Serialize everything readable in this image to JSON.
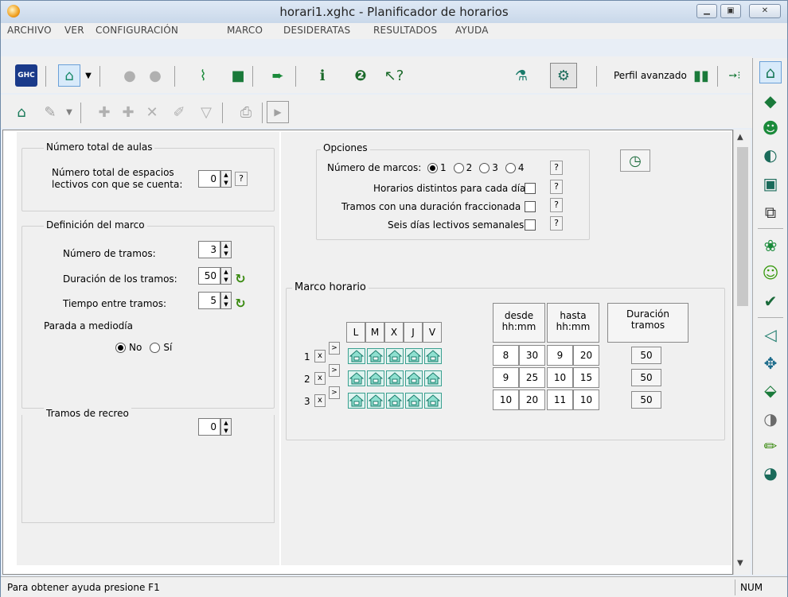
{
  "window": {
    "title": "horari1.xghc - Planificador de horarios"
  },
  "menu": [
    "ARCHIVO",
    "VER",
    "CONFIGURACIÓN",
    "MARCO",
    "DESIDERATAS",
    "RESULTADOS",
    "AYUDA"
  ],
  "toolbar": {
    "ghc_label": "GHC",
    "profile_label": "Perfil avanzado"
  },
  "aulas": {
    "group_label": "Número total de aulas",
    "field_label_line1": "Número total de espacios",
    "field_label_line2": "lectivos con que se cuenta:",
    "value": "0",
    "help": "?"
  },
  "marco_def": {
    "group_label": "Definición del marco",
    "num_tramos_label": "Número de tramos:",
    "num_tramos_value": "3",
    "duracion_label": "Duración de los tramos:",
    "duracion_value": "50",
    "tiempo_label": "Tiempo entre tramos:",
    "tiempo_value": "5"
  },
  "parada": {
    "label": "Parada a mediodía",
    "opt_no": "No",
    "opt_si": "Sí",
    "selected": "No"
  },
  "recreo": {
    "label": "Tramos de recreo",
    "value": "0"
  },
  "opciones": {
    "group_label": "Opciones",
    "num_marcos_label": "Número de marcos:",
    "marcos": [
      "1",
      "2",
      "3",
      "4"
    ],
    "selected_marco": "1",
    "distintos_label": "Horarios distintos para cada día",
    "fraccionada_label": "Tramos con una duración fraccionada",
    "seis_dias_label": "Seis días lectivos semanales",
    "help": "?"
  },
  "marco_horario": {
    "label": "Marco horario",
    "days": [
      "L",
      "M",
      "X",
      "J",
      "V"
    ],
    "desde_header_1": "desde",
    "desde_header_2": "hh:mm",
    "hasta_header_1": "hasta",
    "hasta_header_2": "hh:mm",
    "duracion_header_1": "Duración",
    "duracion_header_2": "tramos",
    "rows": [
      {
        "num": "1",
        "x": "x",
        "next": ">",
        "desde_h": "8",
        "desde_m": "30",
        "hasta_h": "9",
        "hasta_m": "20",
        "duracion": "50"
      },
      {
        "num": "2",
        "x": "x",
        "next": ">",
        "desde_h": "9",
        "desde_m": "25",
        "hasta_h": "10",
        "hasta_m": "15",
        "duracion": "50"
      },
      {
        "num": "3",
        "x": "x",
        "next": ">",
        "desde_h": "10",
        "desde_m": "20",
        "hasta_h": "11",
        "hasta_m": "10",
        "duracion": "50"
      }
    ]
  },
  "status": {
    "help_text": "Para obtener ayuda presione F1",
    "num": "NUM"
  },
  "colors": {
    "accent_green": "#3a8a10",
    "house_teal": "#2a9a88",
    "frame_blue": "#6f8aa8"
  }
}
